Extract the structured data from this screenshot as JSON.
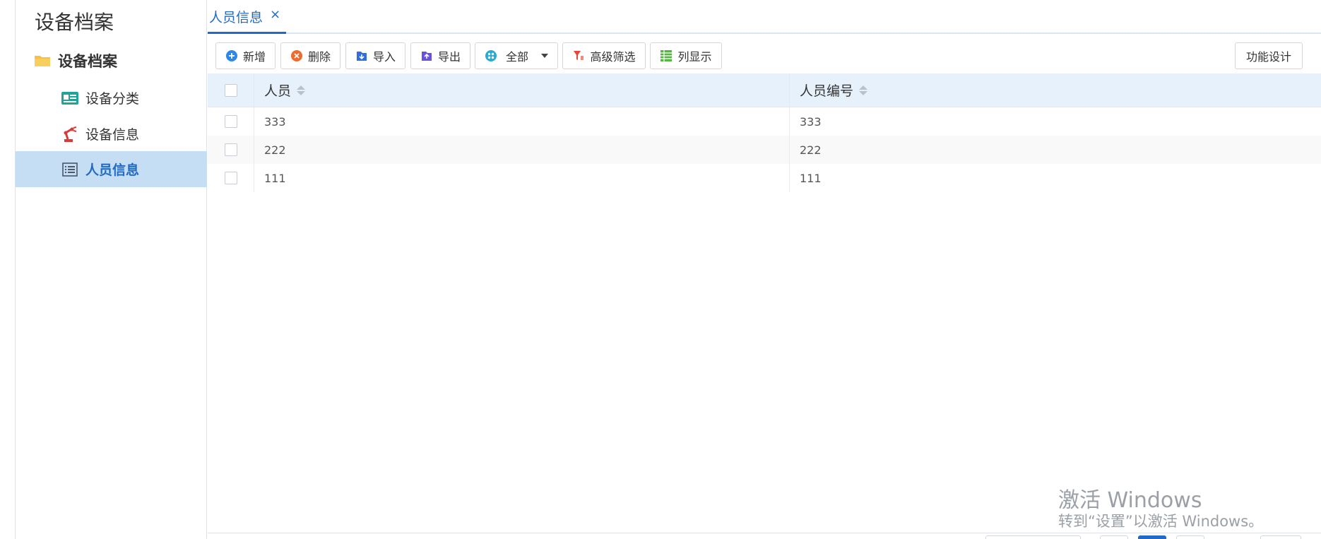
{
  "sidebar": {
    "title": "设备档案",
    "root": {
      "label": "设备档案",
      "icon": "folder-icon"
    },
    "items": [
      {
        "label": "设备分类",
        "icon": "id-card-icon"
      },
      {
        "label": "设备信息",
        "icon": "robot-arm-icon"
      },
      {
        "label": "人员信息",
        "icon": "list-icon",
        "active": true
      }
    ]
  },
  "tabs": [
    {
      "label": "人员信息",
      "close_glyph": "×",
      "active": true
    }
  ],
  "toolbar": {
    "add_label": "新增",
    "delete_label": "删除",
    "import_label": "导入",
    "export_label": "导出",
    "scope_label": "全部",
    "filter_label": "高级筛选",
    "columns_label": "列显示",
    "design_label": "功能设计"
  },
  "grid": {
    "columns": [
      "人员",
      "人员编号"
    ],
    "rows": [
      {
        "person": "333",
        "code": "333"
      },
      {
        "person": "222",
        "code": "222"
      },
      {
        "person": "111",
        "code": "111"
      }
    ]
  },
  "watermark": {
    "line1": "激活 Windows",
    "line2": "转到“设置”以激活 Windows。"
  },
  "colors": {
    "accent": "#1f6bc7",
    "active_row": "#c6def4",
    "header_bg": "#e7f1fb"
  }
}
